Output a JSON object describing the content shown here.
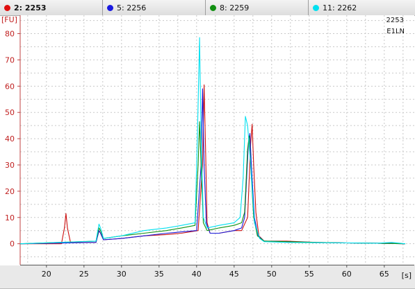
{
  "tabs": [
    {
      "label": "2: 2253",
      "color": "#e01010",
      "active": true
    },
    {
      "label": "5: 2256",
      "color": "#1a1ae0",
      "active": false
    },
    {
      "label": "8: 2259",
      "color": "#129012",
      "active": false
    },
    {
      "label": "11: 2262",
      "color": "#00e0f0",
      "active": false
    }
  ],
  "chart_data": {
    "type": "line",
    "ylabel": "[FU]",
    "xlabel": "[s]",
    "xlim": [
      16.5,
      69
    ],
    "ylim": [
      -8,
      87
    ],
    "xticks": [
      20,
      25,
      30,
      35,
      40,
      45,
      50,
      55,
      60,
      65
    ],
    "yticks": [
      0,
      10,
      20,
      30,
      40,
      50,
      60,
      70,
      80
    ],
    "grid": true,
    "annotations": [
      "2253",
      "E1LN"
    ],
    "series": [
      {
        "name": "2: 2253",
        "color": "#cc1010",
        "x": [
          16.5,
          22,
          22.4,
          22.6,
          22.8,
          23.2,
          26.6,
          27,
          27.2,
          27.6,
          30,
          33,
          36,
          38,
          40.2,
          40.8,
          41.0,
          41.2,
          41.4,
          41.8,
          43,
          45,
          46,
          46.8,
          47.2,
          47.4,
          47.6,
          47.9,
          48.3,
          49,
          52,
          56,
          60,
          64,
          67.8
        ],
        "y": [
          0,
          0,
          6,
          11.5,
          6,
          0.5,
          0.5,
          5,
          4,
          1.5,
          2,
          3,
          3.5,
          4,
          5,
          30,
          60.5,
          35,
          8,
          4,
          4,
          5,
          5,
          10,
          38,
          45.5,
          30,
          12,
          3,
          1,
          1,
          0.5,
          0.3,
          0.2,
          0
        ]
      },
      {
        "name": "5: 2256",
        "color": "#1818d8",
        "x": [
          16.5,
          26.6,
          27,
          27.2,
          27.6,
          30,
          33,
          36,
          38,
          40,
          40.6,
          40.8,
          41,
          41.3,
          41.8,
          43,
          45,
          46,
          46.4,
          46.9,
          47.1,
          47.3,
          47.7,
          48.2,
          49,
          52,
          56,
          60,
          64,
          67.8
        ],
        "y": [
          0,
          0.5,
          5,
          4,
          1.5,
          2,
          3,
          4,
          4.5,
          5,
          30,
          59,
          30,
          8,
          4,
          4,
          5,
          6,
          10,
          38,
          42,
          30,
          10,
          3,
          1,
          0.8,
          0.5,
          0.3,
          0.2,
          0
        ]
      },
      {
        "name": "8: 2259",
        "color": "#109010",
        "x": [
          16.5,
          26.6,
          27,
          27.2,
          27.6,
          30,
          33,
          36,
          38,
          39.8,
          40.2,
          40.4,
          40.6,
          40.9,
          41.4,
          43,
          45,
          46,
          46.4,
          46.8,
          47,
          47.2,
          47.6,
          48.1,
          49,
          52,
          56,
          60,
          64,
          67.8
        ],
        "y": [
          0,
          1,
          6,
          5,
          2,
          3,
          4,
          5,
          6,
          7,
          30,
          46.5,
          30,
          8,
          5,
          6,
          7,
          8,
          12,
          36,
          41,
          30,
          10,
          3,
          1,
          0.8,
          0.5,
          0.3,
          0.2,
          0
        ]
      },
      {
        "name": "11: 2262",
        "color": "#00e0f0",
        "x": [
          16.5,
          26.6,
          27,
          27.2,
          27.6,
          30,
          33,
          36,
          38,
          39.8,
          40.1,
          40.4,
          40.6,
          40.9,
          41.4,
          43,
          45,
          45.8,
          46.2,
          46.5,
          46.8,
          47.2,
          47.7,
          48.4,
          49,
          52,
          56,
          60,
          64,
          66,
          67.8
        ],
        "y": [
          0,
          1,
          7.5,
          6,
          2,
          3,
          5,
          6,
          7,
          8,
          40,
          78.5,
          40,
          10,
          6,
          7,
          8,
          10,
          25,
          48.5,
          45,
          30,
          8,
          2,
          0.8,
          0.5,
          0.4,
          0.3,
          0.2,
          0.5,
          0
        ]
      }
    ]
  }
}
